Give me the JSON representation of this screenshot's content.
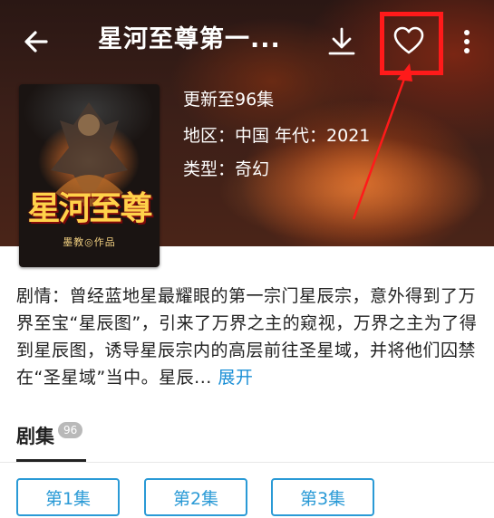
{
  "header": {
    "title": "星河至尊第一...",
    "back_icon": "arrow-left-icon",
    "download_icon": "download-icon",
    "favorite_icon": "heart-outline-icon",
    "more_icon": "more-vertical-icon"
  },
  "annotation": {
    "highlight_color": "#ff1a1a"
  },
  "show": {
    "cover_title": "星河至尊",
    "cover_subtitle": "墨教◎作品",
    "update": "更新至96集",
    "region_year": "地区：中国 年代：2021",
    "genre": "类型：奇幻"
  },
  "synopsis": {
    "text": "剧情：曾经蓝地星最耀眼的第一宗门星辰宗，意外得到了万界至宝“星辰图”，引来了万界之主的窥视，万界之主为了得到星辰图，诱导星辰宗内的高层前往圣星域，并将他们囚禁在“圣星域”当中。星辰...",
    "expand_label": "展开"
  },
  "episodes": {
    "title": "剧集",
    "count": "96",
    "items": [
      "第1集",
      "第2集",
      "第3集"
    ],
    "accent_color": "#2a9ad6"
  }
}
